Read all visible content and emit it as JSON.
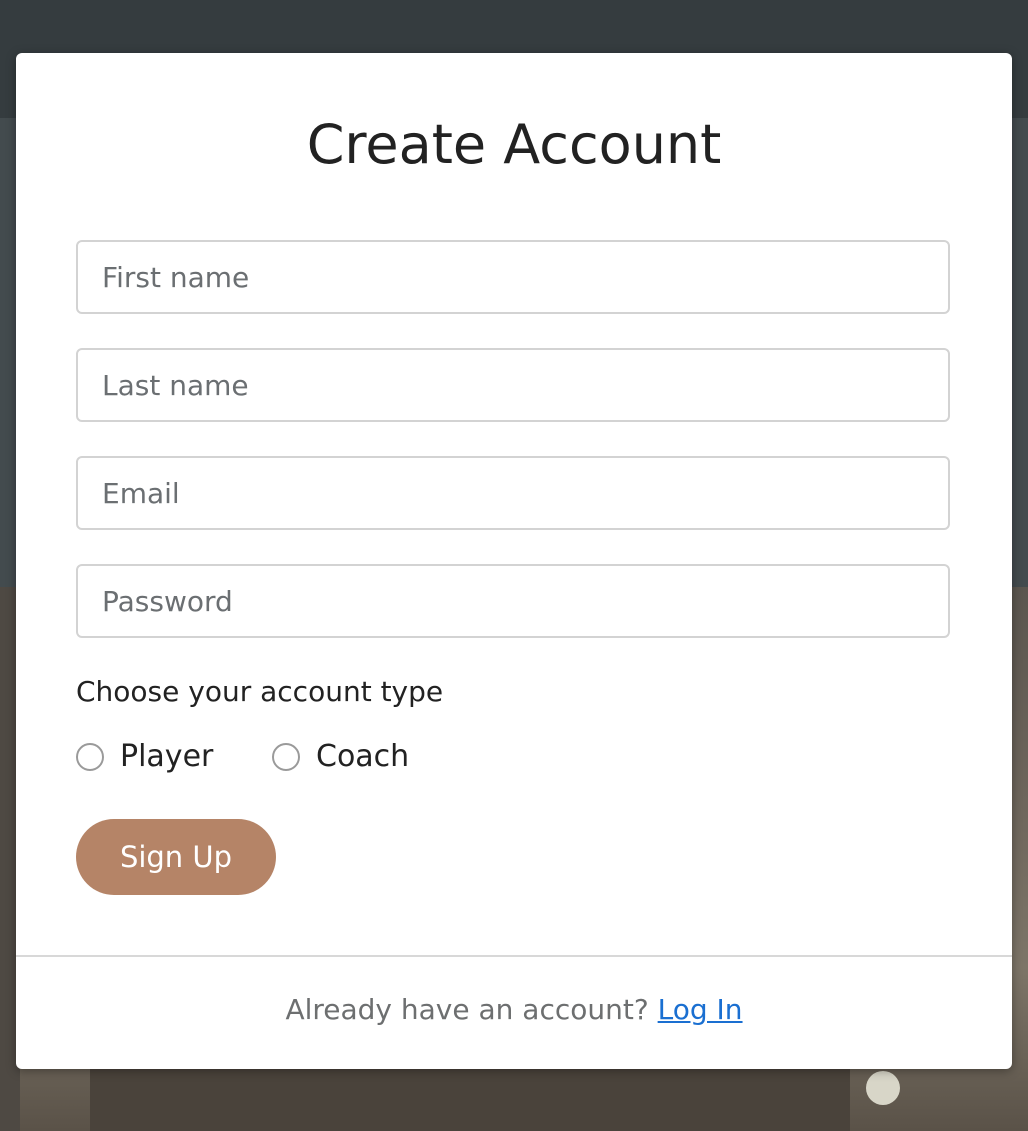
{
  "modal": {
    "title": "Create Account",
    "fields": {
      "first_name_placeholder": "First name",
      "last_name_placeholder": "Last name",
      "email_placeholder": "Email",
      "password_placeholder": "Password"
    },
    "account_type": {
      "label": "Choose your account type",
      "options": [
        "Player",
        "Coach"
      ],
      "selected": null
    },
    "signup_label": "Sign Up",
    "footer": {
      "prompt": "Already have an account?",
      "login_link": "Log In"
    }
  },
  "colors": {
    "signup_button": "#b58467",
    "link": "#1a6fd1",
    "overlay": "#3a4245"
  }
}
